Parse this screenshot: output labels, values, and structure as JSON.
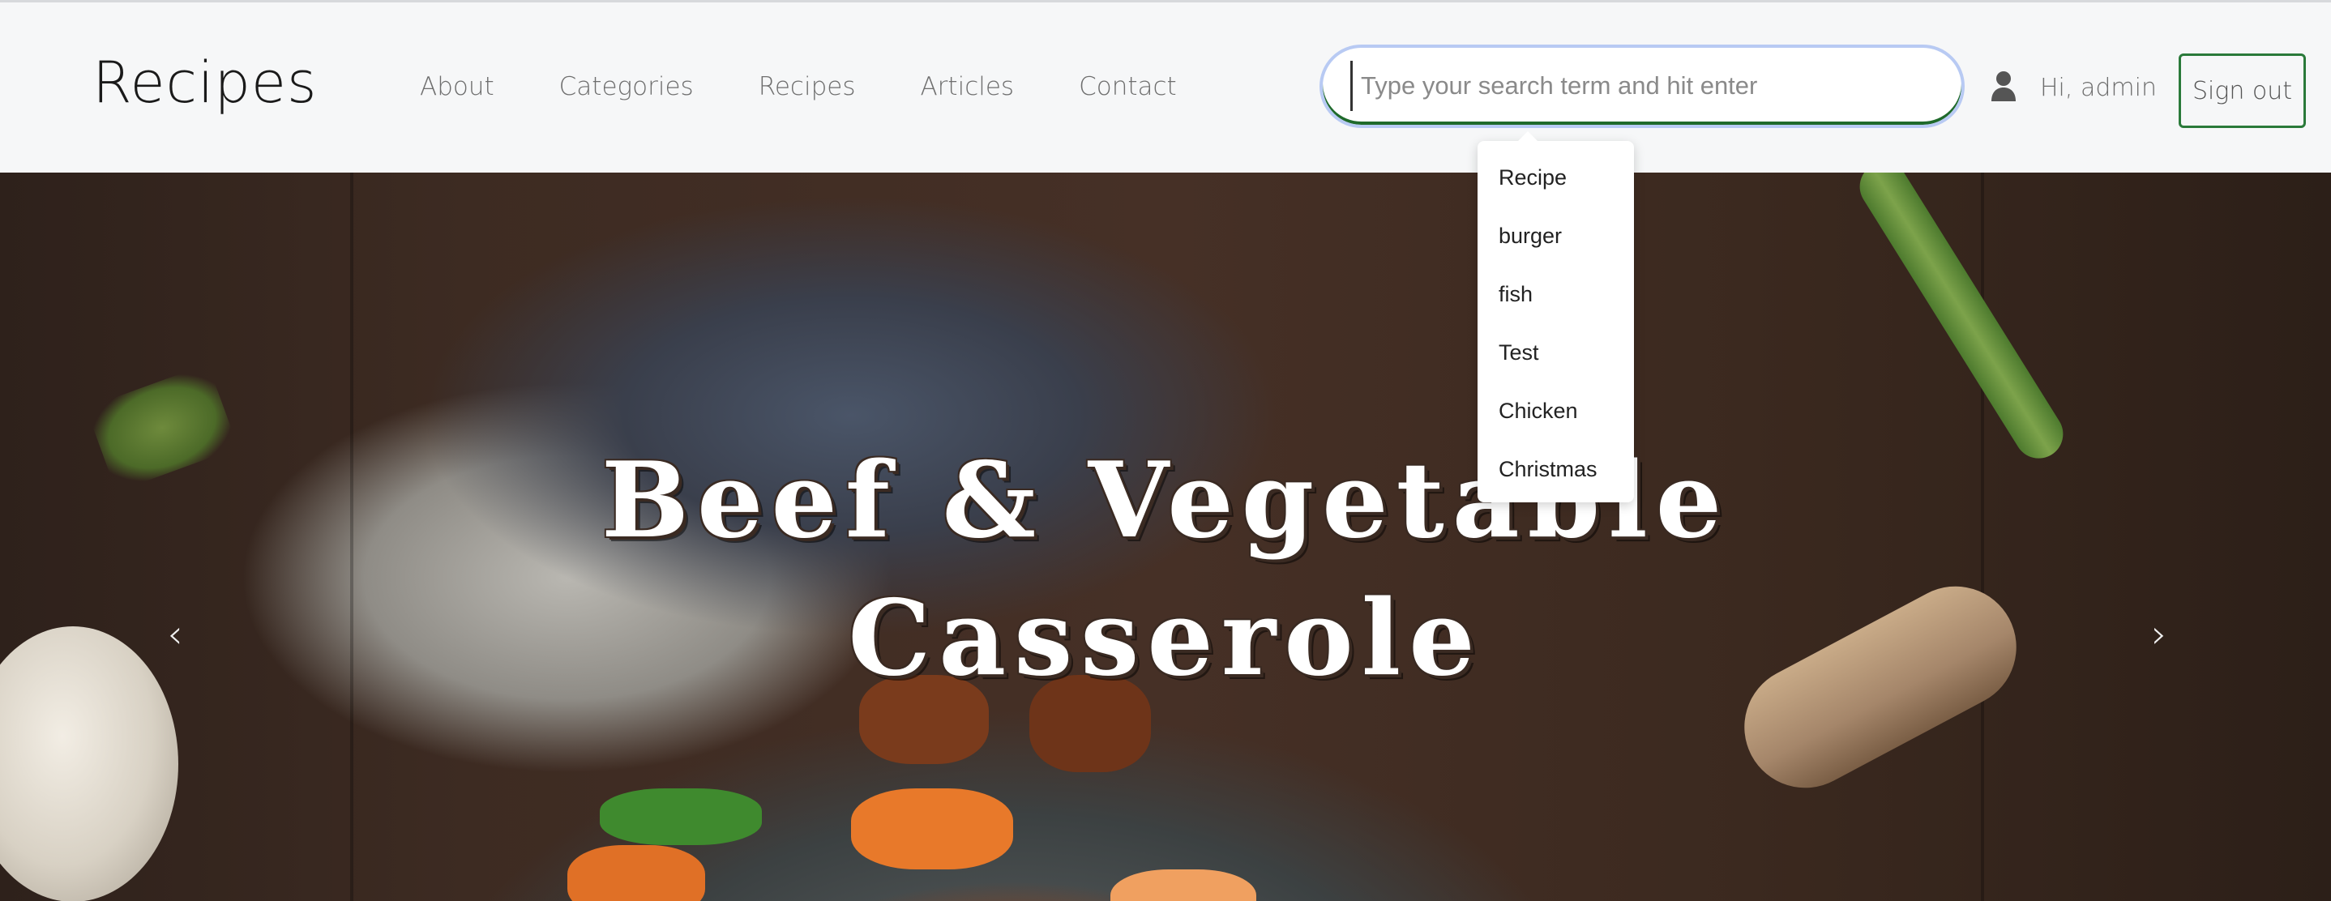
{
  "brand": "Recipes",
  "nav": {
    "items": [
      {
        "label": "About"
      },
      {
        "label": "Categories"
      },
      {
        "label": "Recipes"
      },
      {
        "label": "Articles"
      },
      {
        "label": "Contact"
      }
    ]
  },
  "search": {
    "placeholder": "Type your search term and hit enter",
    "value": "",
    "suggestions": [
      "Recipe",
      "burger",
      "fish",
      "Test",
      "Chicken",
      "Christmas"
    ]
  },
  "user": {
    "icon": "user-icon",
    "greeting": "Hi, admin"
  },
  "actions": {
    "sign_out": "Sign out"
  },
  "hero": {
    "title_line1": "Beef & Vegetable",
    "title_line2": "Casserole",
    "prev_icon": "chevron-left-icon",
    "next_icon": "chevron-right-icon"
  },
  "colors": {
    "navbar_bg": "#f6f7f8",
    "accent_green": "#2a7a3a",
    "search_focus_ring": "#b8caf3"
  }
}
